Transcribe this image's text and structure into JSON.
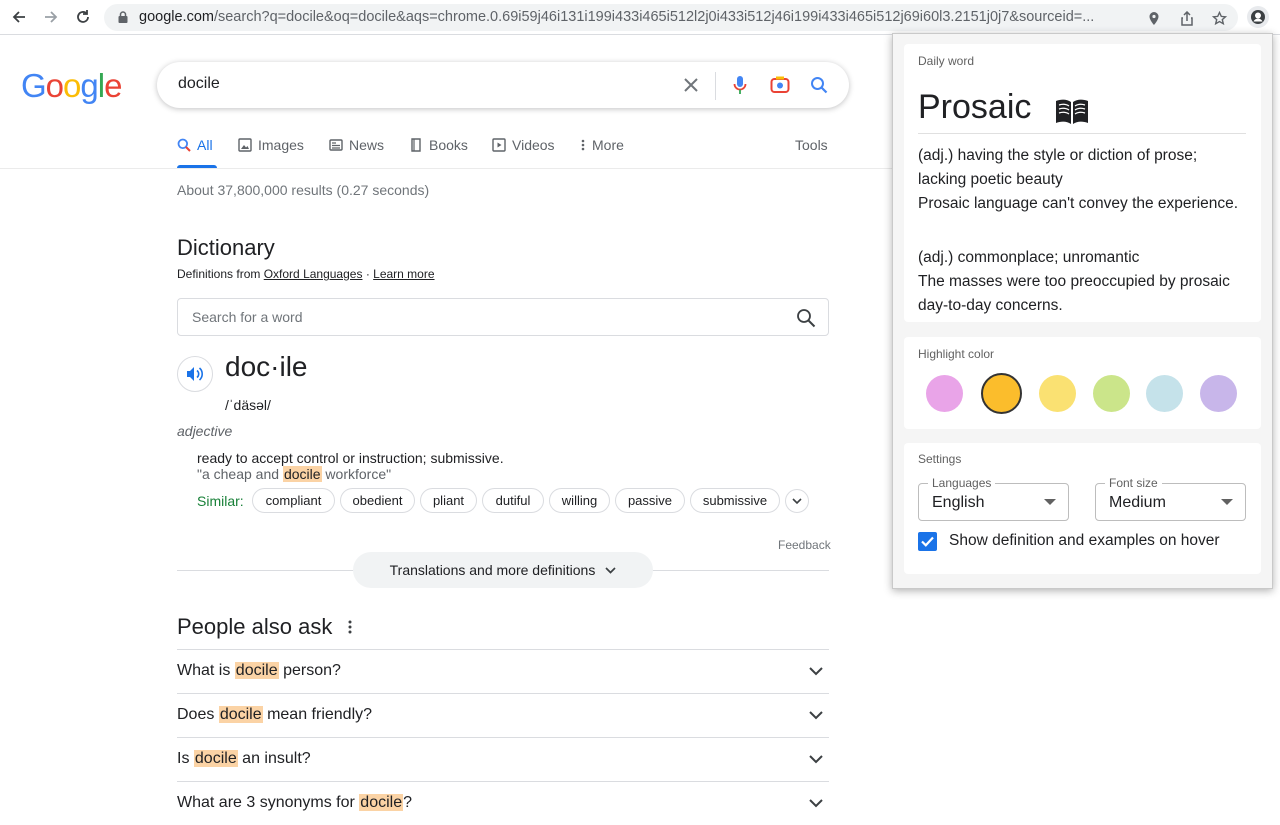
{
  "browser": {
    "url_host": "google.com",
    "url_rest": "/search?q=docile&oq=docile&aqs=chrome.0.69i59j46i131i199i433i465i512l2j0i433i512j46i199i433i465i512j69i60l3.2151j0j7&sourceid=..."
  },
  "google": {
    "logo": [
      "G",
      "o",
      "o",
      "g",
      "l",
      "e"
    ],
    "logo_colors": [
      "#4285F4",
      "#EA4335",
      "#FBBC05",
      "#4285F4",
      "#34A853",
      "#EA4335"
    ],
    "query": "docile",
    "tabs": [
      "All",
      "Images",
      "News",
      "Books",
      "Videos",
      "More"
    ],
    "tools": "Tools",
    "result_stats": "About 37,800,000 results (0.27 seconds)"
  },
  "dictionary": {
    "title": "Dictionary",
    "source_prefix": "Definitions from",
    "source_name": "Oxford Languages",
    "source_sep": "·",
    "learn_more": "Learn more",
    "search_placeholder": "Search for a word",
    "word": "doc·ile",
    "phonetic": "/ˈdäsəl/",
    "part_of_speech": "adjective",
    "definition": "ready to accept control or instruction; submissive.",
    "example_pre": "\"a cheap and",
    "example_hl": "docile",
    "example_post": "workforce\"",
    "similar_label": "Similar:",
    "similar": [
      "compliant",
      "obedient",
      "pliant",
      "dutiful",
      "willing",
      "passive",
      "submissive"
    ],
    "feedback": "Feedback",
    "translations": "Translations and more definitions"
  },
  "people_also_ask": {
    "title": "People also ask",
    "items": [
      {
        "pre": "What is",
        "hl": "docile",
        "post": "person?"
      },
      {
        "pre": "Does",
        "hl": "docile",
        "post": "mean friendly?"
      },
      {
        "pre": "Is",
        "hl": "docile",
        "post": "an insult?"
      },
      {
        "pre": "What are 3 synonyms for",
        "hl": "docile",
        "post": "?"
      }
    ]
  },
  "popup": {
    "daily_word": {
      "label": "Daily word",
      "word": "Prosaic",
      "def1": "(adj.) having the style or diction of prose; lacking poetic beauty",
      "ex1": "Prosaic language can't convey the experience.",
      "def2": "(adj.) commonplace; unromantic",
      "ex2": "The masses were too preoccupied by prosaic day-to-day concerns."
    },
    "highlight": {
      "label": "Highlight color",
      "colors": [
        "#e9a4e8",
        "#fbbd2c",
        "#fae172",
        "#cbe58a",
        "#c5e2ea",
        "#c8b6ea"
      ],
      "selected_index": 1
    },
    "settings": {
      "label": "Settings",
      "languages_label": "Languages",
      "languages_value": "English",
      "font_size_label": "Font size",
      "font_size_value": "Medium",
      "hover_label": "Show definition and examples on hover",
      "hover_checked": true
    }
  }
}
